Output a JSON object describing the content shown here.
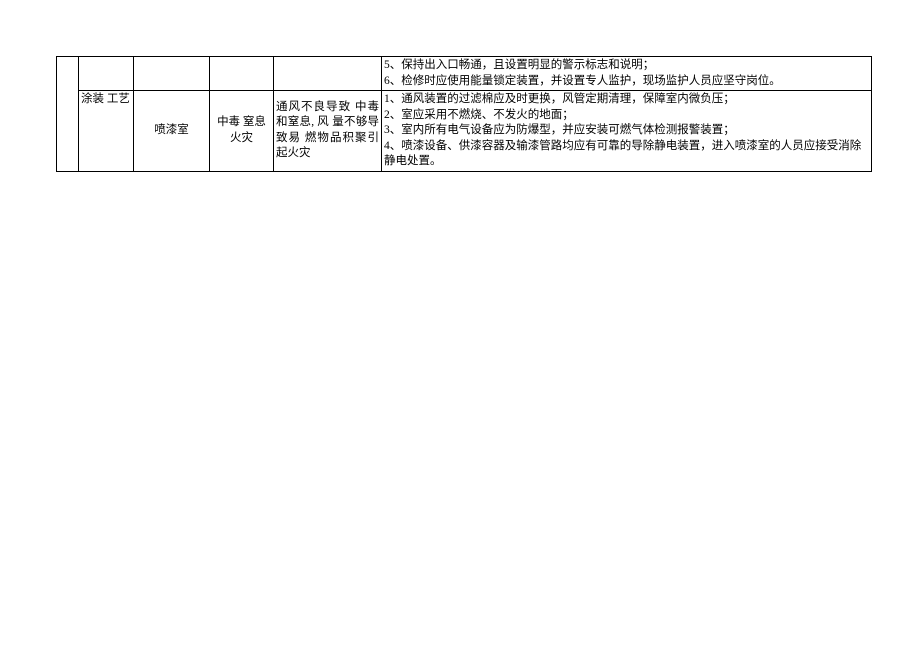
{
  "rows": {
    "top": {
      "cell6_lines": [
        "5、保持出入口畅通，且设置明显的警示标志和说明；",
        "6、检修时应使用能量锁定装置，并设置专人监护，现场监护人员应坚守岗位。"
      ]
    },
    "bottom": {
      "col2": "涂装 工艺",
      "col3": "喷漆室",
      "col4": "中毒 窒息火灾",
      "col5": "通风不良导致 中毒和窒息, 风 量不够导致易 燃物品积聚引 起火灾",
      "col6_lines": [
        "1、通风装置的过滤棉应及时更换，风管定期清理，保障室内微负压；",
        "2、室应采用不燃烧、不发火的地面；",
        "3、室内所有电气设备应为防爆型，并应安装可燃气体检测报警装置；",
        "4、喷漆设备、供漆容器及输漆管路均应有可靠的导除静电装置，进入喷漆室的人员应接受消除静电处置。"
      ]
    }
  }
}
